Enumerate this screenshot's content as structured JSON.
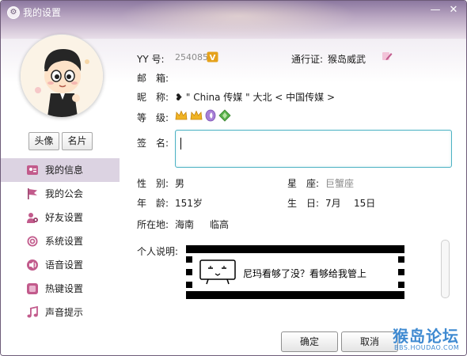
{
  "window": {
    "title": "我的设置",
    "minimize_glyph": "—",
    "close_glyph": "✕"
  },
  "sidebar": {
    "buttons": {
      "avatar": "头像",
      "card": "名片"
    },
    "items": [
      {
        "label": "我的信息",
        "icon": "profile-card-icon"
      },
      {
        "label": "我的公会",
        "icon": "flag-icon"
      },
      {
        "label": "好友设置",
        "icon": "friends-gear-icon"
      },
      {
        "label": "系统设置",
        "icon": "gear-icon"
      },
      {
        "label": "语音设置",
        "icon": "speaker-icon"
      },
      {
        "label": "热键设置",
        "icon": "keyboard-key-icon"
      },
      {
        "label": "声音提示",
        "icon": "music-note-icon"
      }
    ]
  },
  "profile": {
    "yy_label": "YY 号:",
    "yy_value": "254085",
    "pass_label": "通行证:",
    "pass_value": "猴岛威武",
    "email_label": "邮　箱:",
    "nick_label": "昵　称:",
    "nick_value": "❥ \" China 传媒 \" 大北 < 中国传媒 >",
    "level_label": "等　级:",
    "sign_label": "签　名:",
    "sign_value": "",
    "gender_label": "性　别:",
    "gender_value": "男",
    "star_label": "星　座:",
    "star_value": "巨蟹座",
    "age_label": "年　龄:",
    "age_value": "151岁",
    "birthday_label": "生　日:",
    "birthday_month": "7月",
    "birthday_day": "15日",
    "location_label": "所在地:",
    "location_province": "海南",
    "location_city": "临高",
    "desc_label": "个人说明:",
    "desc_text": "尼玛看够了没？看够给我管上"
  },
  "footer": {
    "ok": "确定",
    "cancel": "取消"
  },
  "watermark": {
    "title": "猴岛论坛",
    "url": "BBS.HOUDAO.COM"
  }
}
